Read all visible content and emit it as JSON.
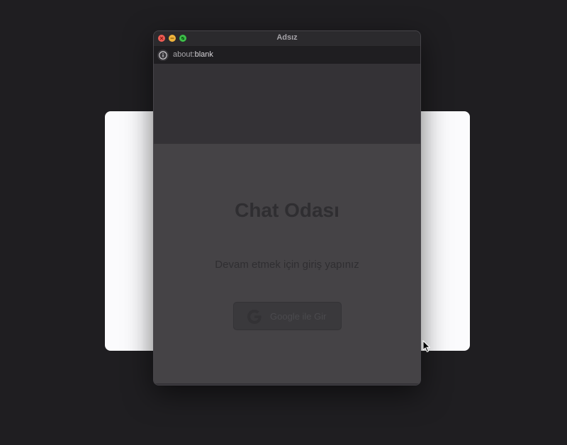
{
  "window": {
    "title": "Adsız"
  },
  "address_bar": {
    "scheme": "about:",
    "path": "blank",
    "info_icon": "info-icon"
  },
  "page": {
    "heading": "Chat Odası",
    "subtitle": "Devam etmek için giriş yapınız",
    "google_button_label": "Google ile Gir",
    "google_icon": "google-g-icon"
  },
  "colors": {
    "desktop_background": "#1f1e21",
    "card_background": "#fbfbfd",
    "popup_background": "#312f33",
    "traffic_close": "#ee5d55",
    "traffic_minimize": "#f0b43d",
    "traffic_maximize": "#3dbf49"
  }
}
